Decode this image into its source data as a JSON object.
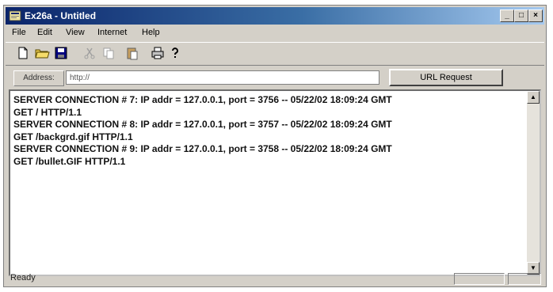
{
  "window": {
    "title": "Ex26a - Untitled"
  },
  "window_controls": {
    "minimize": "_",
    "maximize": "□",
    "close": "×"
  },
  "menu": [
    "File",
    "Edit",
    "View",
    "Internet",
    "Help"
  ],
  "toolbar": {
    "icons": [
      "new-document-icon",
      "open-folder-icon",
      "save-disk-icon",
      "cut-icon",
      "copy-icon",
      "paste-icon",
      "print-icon",
      "help-icon"
    ]
  },
  "address": {
    "label": "Address:",
    "value": "http://"
  },
  "url_button": {
    "label": "URL Request"
  },
  "log": {
    "lines": [
      "SERVER CONNECTION # 7: IP addr = 127.0.0.1, port = 3756 -- 05/22/02 18:09:24 GMT",
      "GET / HTTP/1.1",
      "SERVER CONNECTION # 8: IP addr = 127.0.0.1, port = 3757 -- 05/22/02 18:09:24 GMT",
      "GET /backgrd.gif HTTP/1.1",
      "SERVER CONNECTION # 9: IP addr = 127.0.0.1, port = 3758 -- 05/22/02 18:09:24 GMT",
      "GET /bullet.GIF HTTP/1.1"
    ]
  },
  "status": {
    "text": "Ready"
  }
}
